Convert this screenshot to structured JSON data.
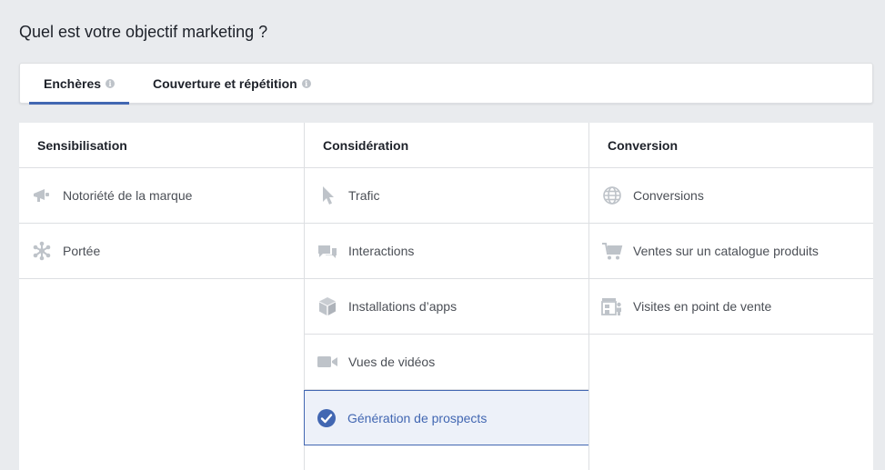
{
  "page": {
    "title": "Quel est votre objectif marketing ?"
  },
  "tabs": [
    {
      "label": "Enchères",
      "active": true
    },
    {
      "label": "Couverture et répétition",
      "active": false
    }
  ],
  "columns": [
    {
      "header": "Sensibilisation",
      "items": [
        {
          "label": "Notoriété de la marque",
          "icon": "megaphone-icon"
        },
        {
          "label": "Portée",
          "icon": "reach-icon"
        }
      ]
    },
    {
      "header": "Considération",
      "items": [
        {
          "label": "Trafic",
          "icon": "cursor-icon"
        },
        {
          "label": "Interactions",
          "icon": "chat-bubbles-icon"
        },
        {
          "label": "Installations d’apps",
          "icon": "cube-icon"
        },
        {
          "label": "Vues de vidéos",
          "icon": "video-camera-icon"
        },
        {
          "label": "Génération de prospects",
          "icon": "check-circle-icon",
          "selected": true
        }
      ]
    },
    {
      "header": "Conversion",
      "items": [
        {
          "label": "Conversions",
          "icon": "globe-icon"
        },
        {
          "label": "Ventes sur un catalogue produits",
          "icon": "shopping-cart-icon"
        },
        {
          "label": "Visites en point de vente",
          "icon": "store-icon"
        }
      ]
    }
  ],
  "colors": {
    "accent": "#4267b2",
    "icon_gray": "#bec3c9",
    "selected_bg": "#edf1f9",
    "page_bg": "#e9ebee"
  }
}
